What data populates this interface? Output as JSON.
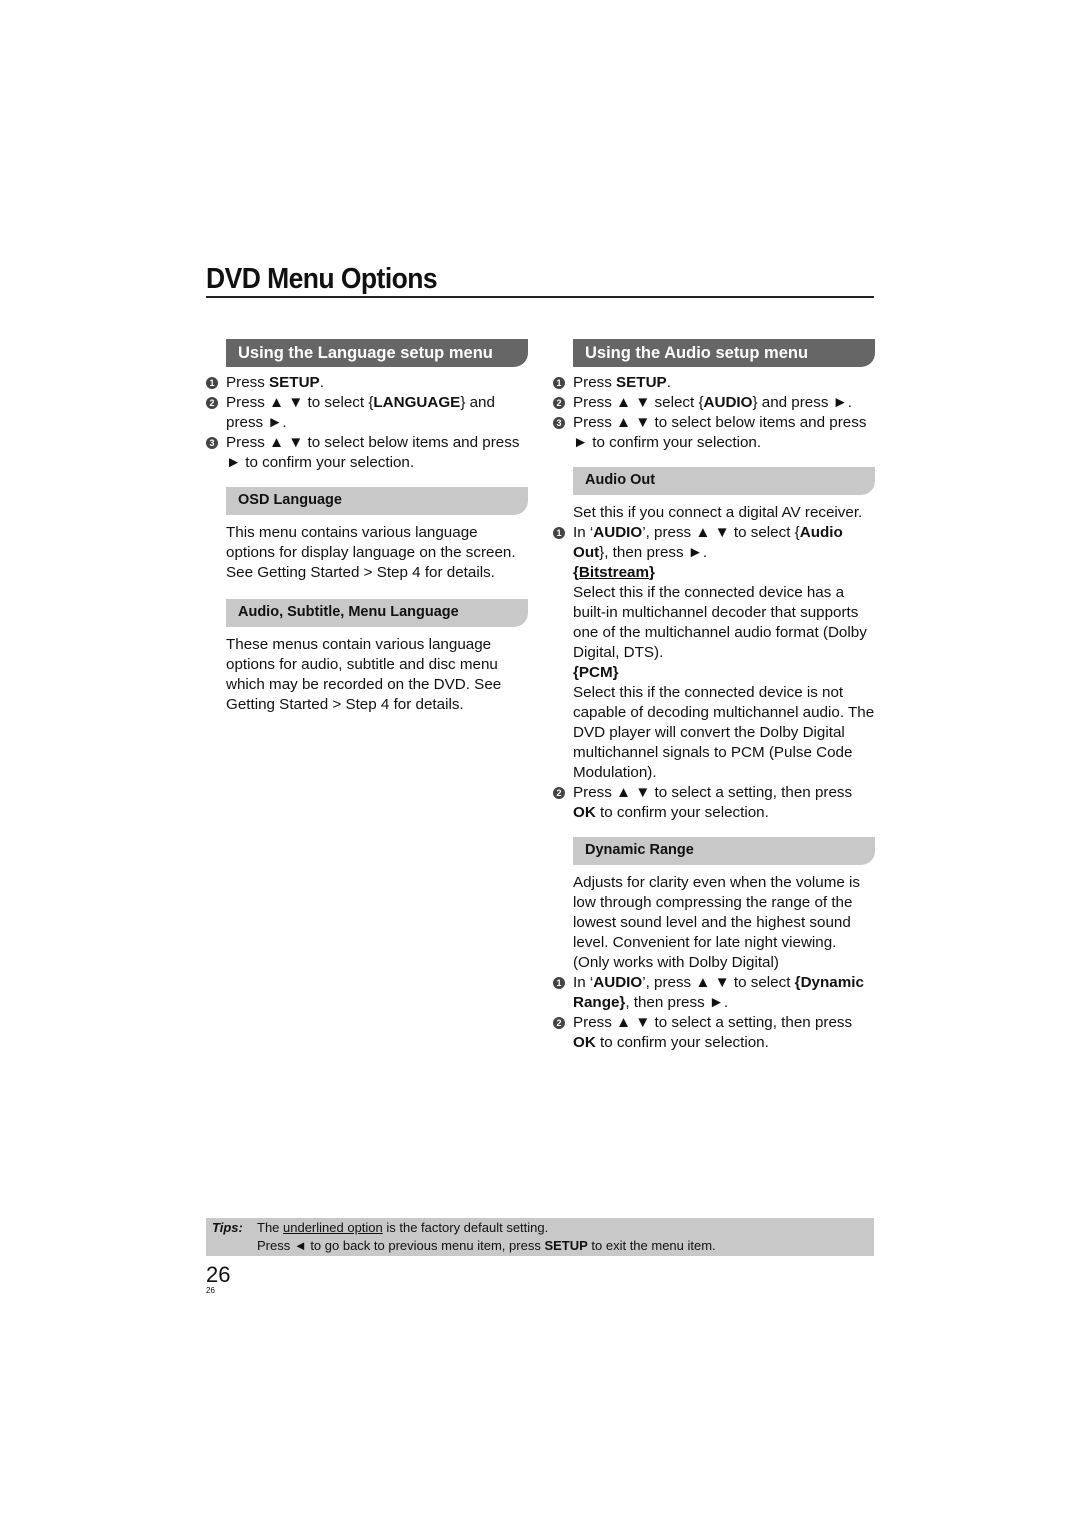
{
  "page": {
    "title": "DVD Menu Options",
    "page_number": "26",
    "page_number_small": "26"
  },
  "left_column": {
    "header": "Using the Language setup menu",
    "steps": [
      {
        "num": "1",
        "segments": [
          {
            "t": "Press "
          },
          {
            "t": "SETUP",
            "b": true
          },
          {
            "t": "."
          }
        ]
      },
      {
        "num": "2",
        "segments": [
          {
            "t": "Press ▲ ▼ to select {"
          },
          {
            "t": "LANGUAGE",
            "b": true
          },
          {
            "t": "} and press ►."
          }
        ]
      },
      {
        "num": "3",
        "segments": [
          {
            "t": "Press ▲ ▼ to select below items and press ► to confirm your selection."
          }
        ]
      }
    ],
    "subsections": [
      {
        "title": "OSD Language",
        "text": "This menu contains various language options for display language on the screen. See Getting Started > Step 4 for details."
      },
      {
        "title": "Audio, Subtitle, Menu Language",
        "text": "These menus contain various language options for audio, subtitle and disc menu which may be recorded on the DVD. See Getting Started > Step 4 for details."
      }
    ]
  },
  "right_column": {
    "header": "Using the Audio setup menu",
    "steps": [
      {
        "num": "1",
        "segments": [
          {
            "t": "Press "
          },
          {
            "t": "SETUP",
            "b": true
          },
          {
            "t": "."
          }
        ]
      },
      {
        "num": "2",
        "segments": [
          {
            "t": "Press ▲ ▼ select {"
          },
          {
            "t": "AUDIO",
            "b": true
          },
          {
            "t": "} and press ►."
          }
        ]
      },
      {
        "num": "3",
        "segments": [
          {
            "t": "Press ▲ ▼ to select below items and press ► to confirm your selection."
          }
        ]
      }
    ],
    "audio_out": {
      "title": "Audio Out",
      "intro": "Set this if you connect a digital AV receiver.",
      "step1": {
        "num": "1",
        "segments": [
          {
            "t": "In ‘"
          },
          {
            "t": "AUDIO",
            "b": true
          },
          {
            "t": "’, press ▲ ▼ to select {"
          },
          {
            "t": "Audio Out",
            "b": true
          },
          {
            "t": "}, then press ►."
          }
        ]
      },
      "options": [
        {
          "label": "Bitstream",
          "default": true,
          "text": "Select this if the connected device has a built-in multichannel decoder that supports one of the multichannel audio format (Dolby Digital, DTS)."
        },
        {
          "label": "PCM",
          "default": false,
          "text": "Select this if the connected device is not capable of decoding multichannel audio. The DVD player will convert the Dolby Digital multichannel signals to PCM (Pulse Code Modulation)."
        }
      ],
      "step2": {
        "num": "2",
        "segments": [
          {
            "t": "Press ▲ ▼ to select a setting, then press "
          },
          {
            "t": "OK",
            "b": true
          },
          {
            "t": " to confirm your selection."
          }
        ]
      }
    },
    "dynamic_range": {
      "title": "Dynamic Range",
      "intro": "Adjusts for clarity even when the volume is low through compressing the range of the lowest sound level and the highest sound level. Convenient for late night viewing. (Only works with Dolby Digital)",
      "step1": {
        "num": "1",
        "segments": [
          {
            "t": "In ‘"
          },
          {
            "t": "AUDIO",
            "b": true
          },
          {
            "t": "’, press ▲ ▼ to select "
          },
          {
            "t": "{Dynamic Range}",
            "b": true
          },
          {
            "t": ", then press ►."
          }
        ]
      },
      "step2": {
        "num": "2",
        "segments": [
          {
            "t": "Press ▲ ▼ to select a setting, then press "
          },
          {
            "t": "OK",
            "b": true
          },
          {
            "t": " to confirm your selection."
          }
        ]
      }
    }
  },
  "tips": {
    "label": "Tips:",
    "line1": [
      {
        "t": "The "
      },
      {
        "t": "underlined option",
        "u": true
      },
      {
        "t": " is the factory default setting."
      }
    ],
    "line2": [
      {
        "t": "Press ◄ to go back to previous menu item, press "
      },
      {
        "t": "SETUP",
        "b": true
      },
      {
        "t": " to exit the menu item."
      }
    ]
  },
  "colors": {
    "section_header_bg": "#666666",
    "subsection_header_bg": "#c8c8c8",
    "tips_bg": "#c8c8c8",
    "text": "#111111"
  }
}
